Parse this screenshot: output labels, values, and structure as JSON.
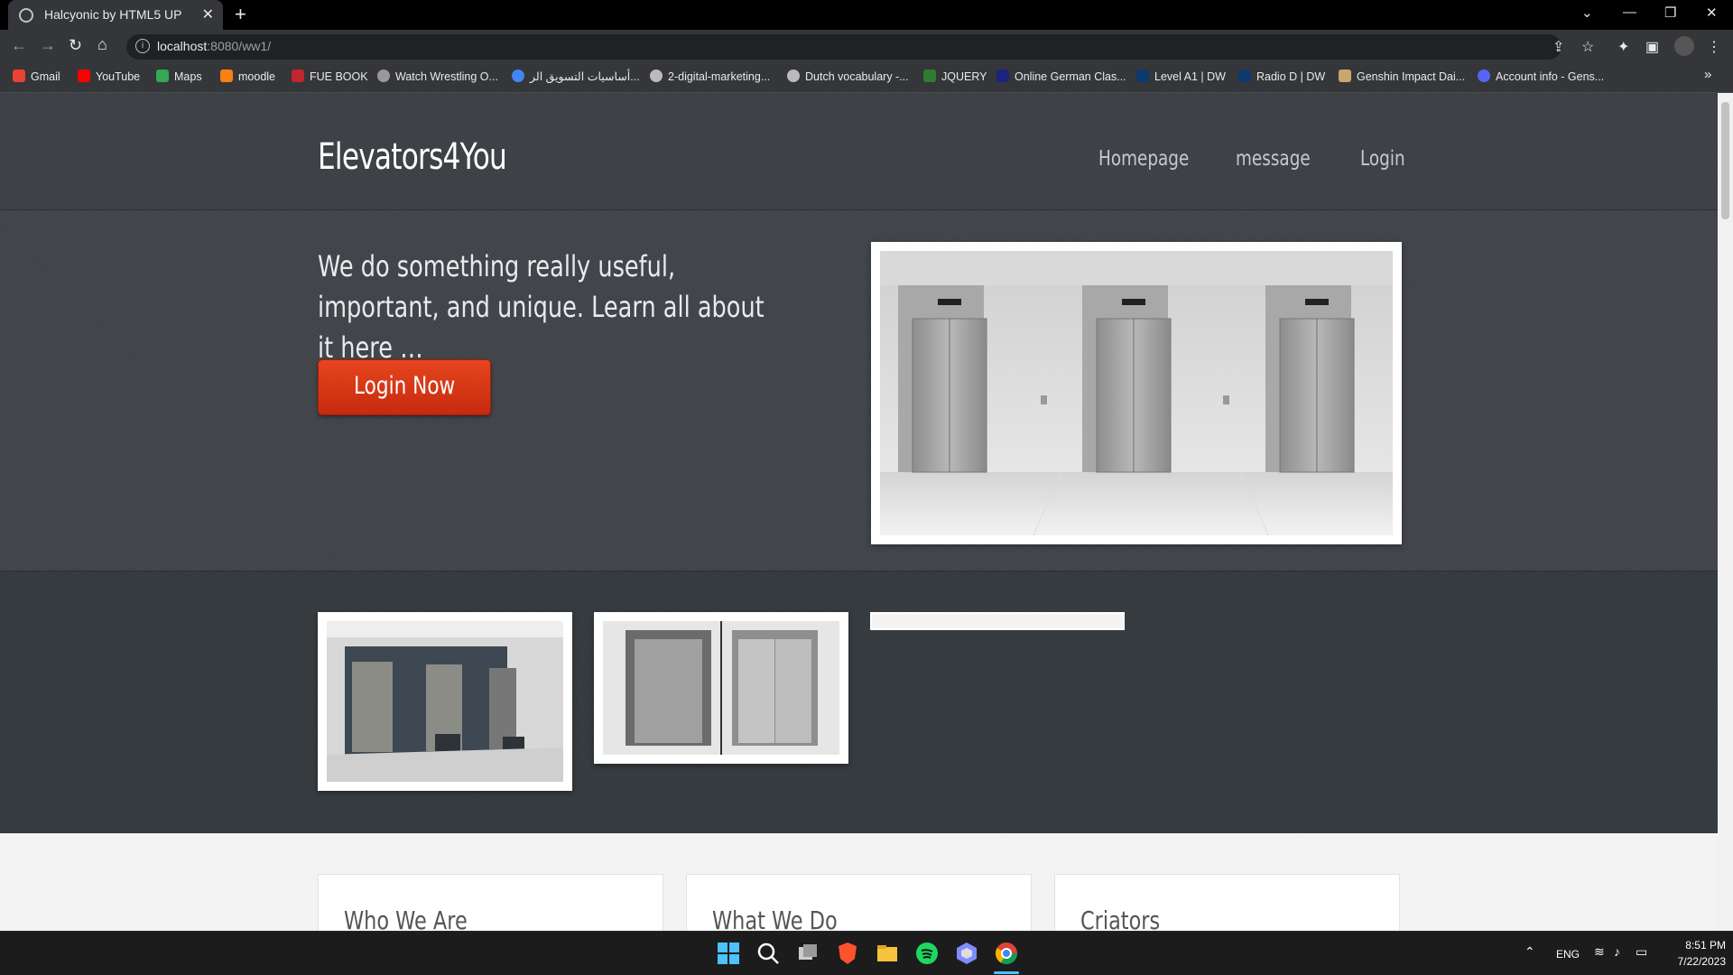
{
  "browser": {
    "tab_title": "Halcyonic by HTML5 UP",
    "url_host": "localhost",
    "url_path": ":8080/ww1/",
    "bookmarks": [
      "Gmail",
      "YouTube",
      "Maps",
      "moodle",
      "FUE BOOK",
      "Watch Wrestling O...",
      "أساسيات التسويق الر...",
      "2-digital-marketing...",
      "Dutch vocabulary -...",
      "JQUERY",
      "Online German Clas...",
      "Level A1 | DW",
      "Radio D | DW",
      "Genshin Impact Dai...",
      "Account info - Gens..."
    ],
    "more_bookmarks": "»"
  },
  "site": {
    "logo": "Elevators4You",
    "menu": [
      "Homepage",
      "message",
      "Login"
    ],
    "tagline": "We do something really useful, important, and unique. Learn all about it here …",
    "cta": "Login Now",
    "cards": [
      "Who We Are",
      "What We Do",
      "Criators"
    ]
  },
  "taskbar": {
    "lang": "ENG",
    "time": "8:51 PM",
    "date": "7/22/2023"
  },
  "colors": {
    "accent": "#d6361a",
    "header_bg": "#3d4145"
  }
}
